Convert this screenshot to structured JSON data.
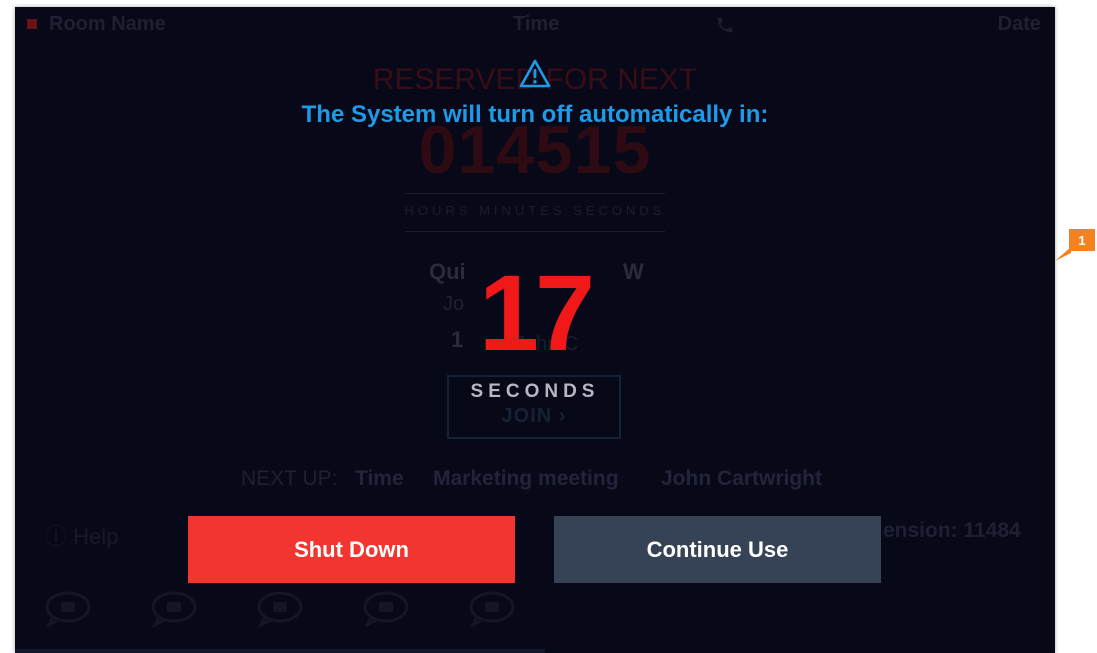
{
  "background": {
    "header": {
      "room": "Room Name",
      "time": "Time",
      "date": "Date"
    },
    "reserved_title": "RESERVED FOR NEXT",
    "reserved_code": "014515",
    "reserved_sub": "HOURS MINUTES SECONDS",
    "meeting": {
      "title_start": "Qui",
      "title_end": "W",
      "organizer": "Jo",
      "count": "1",
      "attendee": "John C"
    },
    "join_label": "JOIN ›",
    "next_up": {
      "label": "NEXT UP:",
      "time": "Time",
      "title": "Marketing meeting",
      "owner": "John Cartwright"
    },
    "help": "Help",
    "extension": "ension: 11484"
  },
  "modal": {
    "message": "The System will turn off automatically in:",
    "countdown": "17",
    "unit": "SECONDS",
    "shutdown_label": "Shut Down",
    "continue_label": "Continue Use"
  },
  "callout": {
    "label": "1"
  },
  "colors": {
    "accent_blue": "#1e9be8",
    "countdown_red": "#f01818",
    "shutdown_red": "#f2352e",
    "continue_slate": "#364256",
    "callout_orange": "#f58220"
  }
}
